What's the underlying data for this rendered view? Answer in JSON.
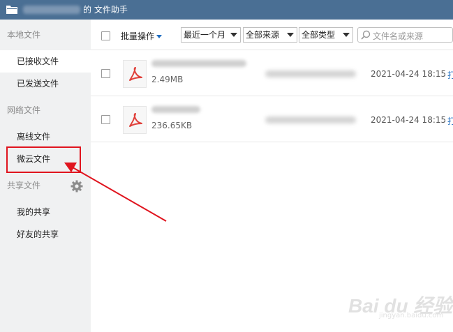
{
  "titlebar": {
    "title": "的 文件助手",
    "folder_icon": "folder-icon"
  },
  "sidebar": {
    "sections": [
      {
        "label": "本地文件",
        "items": [
          {
            "label": "已接收文件",
            "active": true
          },
          {
            "label": "已发送文件"
          }
        ]
      },
      {
        "label": "网络文件",
        "items": [
          {
            "label": "离线文件"
          },
          {
            "label": "微云文件"
          }
        ]
      },
      {
        "label": "共享文件",
        "items": [
          {
            "label": "我的共享"
          },
          {
            "label": "好友的共享"
          }
        ]
      }
    ],
    "settings_icon": "gear-icon"
  },
  "toolbar": {
    "batch_label": "批量操作",
    "time_filter": "最近一个月",
    "source_filter": "全部来源",
    "type_filter": "全部类型",
    "search_placeholder": "文件名或来源"
  },
  "files": [
    {
      "icon": "pdf-icon",
      "size": "2.49MB",
      "date": "2021-04-24 18:15",
      "action": "打"
    },
    {
      "icon": "pdf-icon",
      "size": "236.65KB",
      "date": "2021-04-24 18:15",
      "action": "打"
    }
  ],
  "watermark": {
    "brand": "Bai du 经验",
    "url": "jingyan.baidu.com"
  },
  "colors": {
    "titlebar": "#4a6f94",
    "sidebar": "#f0f1f2",
    "annotation": "#e0141e",
    "link": "#1d6cc1",
    "pdf": "#e0403a"
  }
}
